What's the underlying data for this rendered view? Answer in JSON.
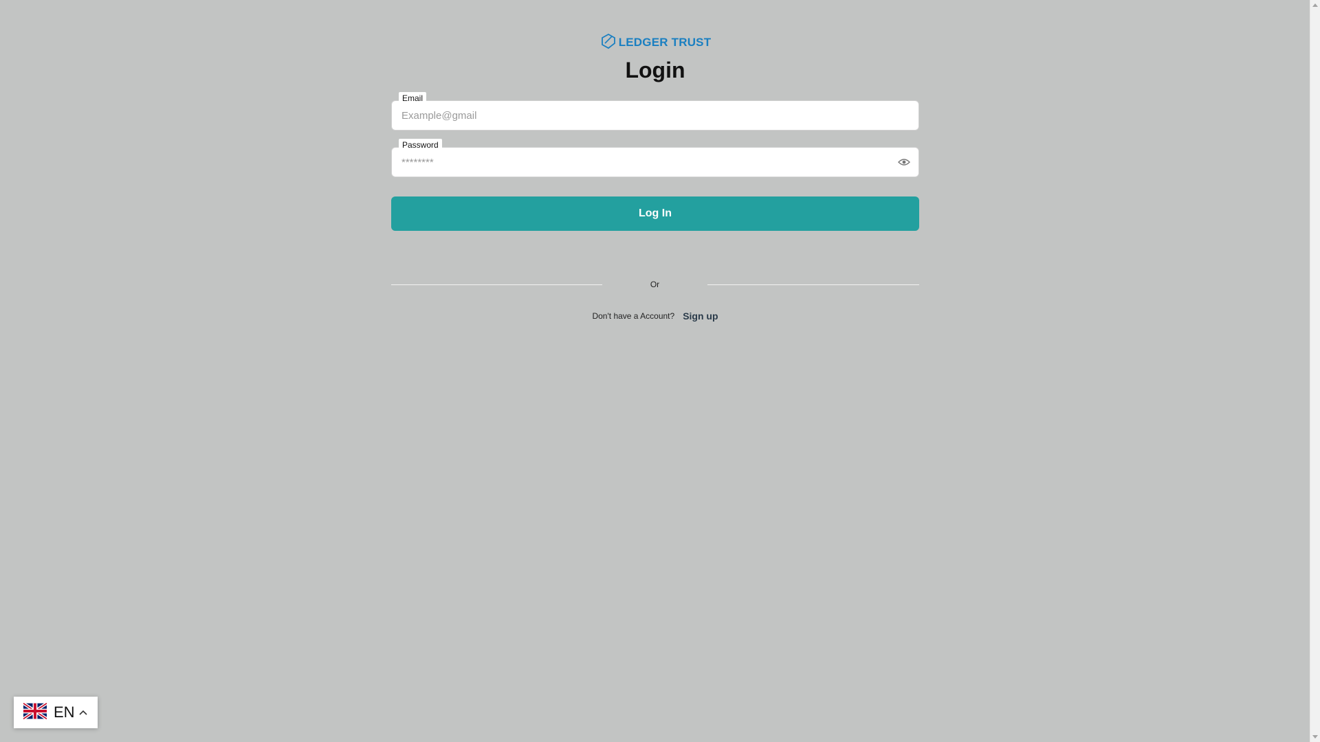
{
  "brand": {
    "name": "LEDGER TRUST",
    "color": "#1a7fc1"
  },
  "login": {
    "title": "Login",
    "email": {
      "label": "Email",
      "placeholder": "Example@gmail",
      "value": ""
    },
    "password": {
      "label": "Password",
      "placeholder": "********",
      "value": "",
      "toggle_icon": "eye-icon"
    },
    "submit_label": "Log In",
    "divider_text": "Or",
    "signup_prompt": "Don't have a Account?",
    "signup_link": "Sign up"
  },
  "language": {
    "code": "EN",
    "flag_icon": "uk-flag-icon",
    "caret_icon": "chevron-up-icon"
  },
  "colors": {
    "background": "#c2c4c3",
    "primary_button": "#23a09f"
  }
}
